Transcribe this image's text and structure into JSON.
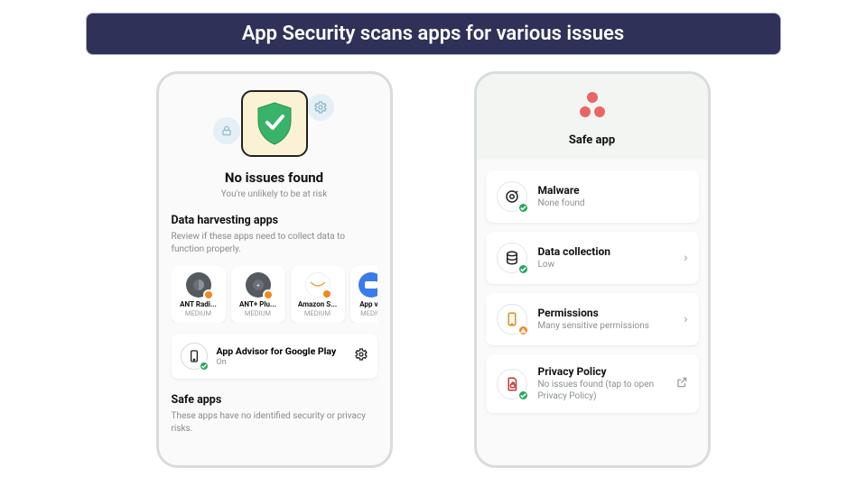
{
  "banner": "App Security scans apps for various issues",
  "left": {
    "status_title": "No issues found",
    "status_sub": "You're unlikely to be at risk",
    "harvest_title": "Data harvesting apps",
    "harvest_desc": "Review if these apps need to collect data to function properly.",
    "apps": [
      {
        "name": "ANT Radi...",
        "risk": "MEDIUM"
      },
      {
        "name": "ANT+ Plu...",
        "risk": "MEDIUM"
      },
      {
        "name": "Amazon S...",
        "risk": "MEDIUM"
      },
      {
        "name": "App va",
        "risk": "MEDIU"
      }
    ],
    "advisor_title": "App Advisor for Google Play",
    "advisor_status": "On",
    "safe_title": "Safe apps",
    "safe_desc": "These apps have no identified security or privacy risks."
  },
  "right": {
    "title": "Safe app",
    "items": [
      {
        "title": "Malware",
        "sub": "None found",
        "badge": "#26a65b",
        "action": "none"
      },
      {
        "title": "Data collection",
        "sub": "Low",
        "badge": "#26a65b",
        "action": "chevron"
      },
      {
        "title": "Permissions",
        "sub": "Many sensitive permissions",
        "badge": "#f08a1f",
        "action": "chevron"
      },
      {
        "title": "Privacy Policy",
        "sub": "No issues found (tap to open Privacy Policy)",
        "badge": "#26a65b",
        "action": "external"
      }
    ]
  }
}
